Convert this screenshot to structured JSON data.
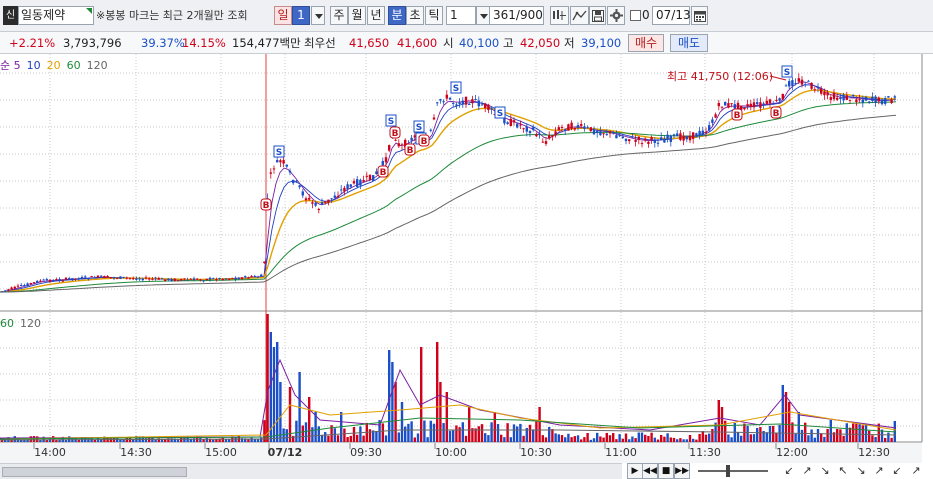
{
  "toolbar": {
    "market_badge": "신",
    "stock_name": "일동제약",
    "notice": "※봉봉 마크는 최근 2개월만 조회",
    "period_buttons": [
      {
        "label": "일",
        "selected": false,
        "style": "red"
      },
      {
        "label": "1",
        "selected": true
      },
      {
        "label": "주",
        "selected": false
      },
      {
        "label": "월",
        "selected": false
      },
      {
        "label": "년",
        "selected": false
      },
      {
        "label": "분",
        "selected": true
      },
      {
        "label": "초",
        "selected": false
      },
      {
        "label": "틱",
        "selected": false
      }
    ],
    "interval_value": "1",
    "count_value": "361/900",
    "date_value": "07/13",
    "tool_icons": [
      "crosshair-icon",
      "draw-tool-icon",
      "save-icon",
      "settings-icon"
    ]
  },
  "quote": {
    "change_rate": "+2.21%",
    "volume": "3,793,796",
    "rate1": "39.37%",
    "rate2": "14.15%",
    "amount": "154,477백만",
    "best_ask_label": "최우선",
    "best_ask": "41,650",
    "best_bid": "41,600",
    "open_label": "시",
    "open": "40,100",
    "high_label": "고",
    "high": "42,050",
    "low_label": "저",
    "low": "39,100",
    "buy_label": "매수",
    "sell_label": "매도"
  },
  "chart": {
    "price_legend": [
      "순 5",
      "10",
      "20",
      "60",
      "120"
    ],
    "volume_legend": [
      "60",
      "120"
    ],
    "high_marker": "최고 41,750 (12:06)",
    "time_labels": [
      "14:00",
      "14:30",
      "15:00",
      "07/12",
      "09:30",
      "10:00",
      "10:30",
      "11:00",
      "11:30",
      "12:00",
      "12:30"
    ],
    "signals": [
      {
        "type": "S",
        "t": "09:07"
      },
      {
        "type": "B",
        "t": "09:01"
      },
      {
        "type": "B",
        "t": "09:43"
      },
      {
        "type": "S",
        "t": "09:47"
      },
      {
        "type": "B",
        "t": "09:48"
      },
      {
        "type": "S",
        "t": "09:56"
      },
      {
        "type": "B",
        "t": "09:57"
      },
      {
        "type": "S",
        "t": "09:59"
      },
      {
        "type": "B",
        "t": "09:59"
      },
      {
        "type": "S",
        "t": "10:07"
      },
      {
        "type": "S",
        "t": "10:23"
      },
      {
        "type": "B",
        "t": "11:48"
      },
      {
        "type": "B",
        "t": "12:01"
      },
      {
        "type": "S",
        "t": "12:05"
      }
    ],
    "colors": {
      "up": "#d0021b",
      "down": "#1a4fc7",
      "ma5": "#7b1fa2",
      "ma10": "#1e3fc0",
      "ma20": "#e0a000",
      "ma60": "#1e8a3a",
      "ma120": "#666666",
      "session_line": "#e04040"
    }
  },
  "bottom": {
    "playback_buttons": [
      "▶",
      "◀◀",
      "■",
      "▶▶"
    ]
  }
}
